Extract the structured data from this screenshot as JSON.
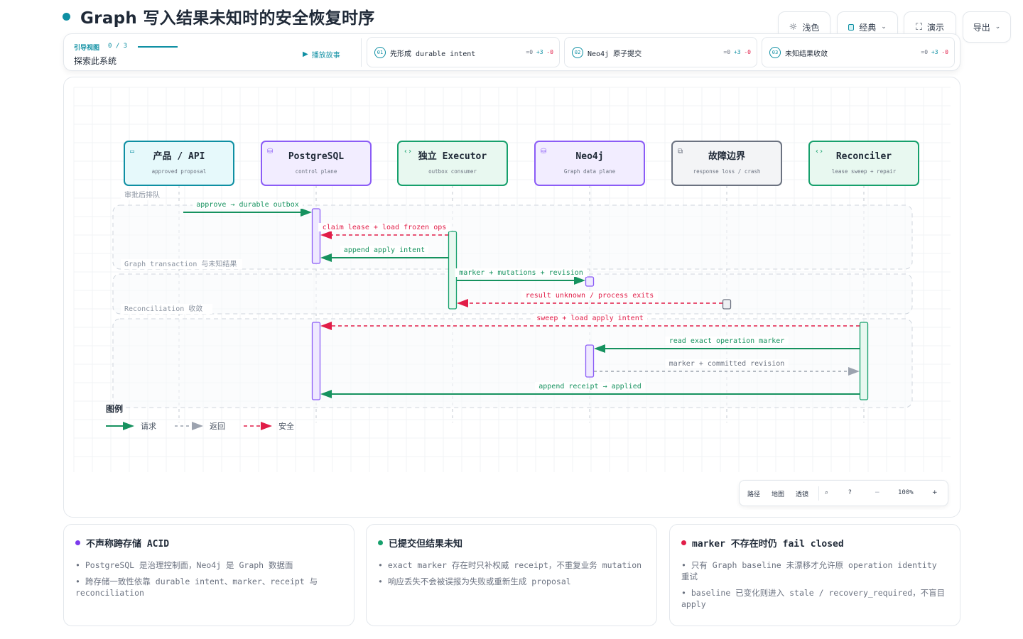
{
  "header": {
    "title": "Graph  写入结果未知时的安全恢复时序"
  },
  "toolbar": {
    "light_label": "浅色",
    "theme_label": "经典",
    "present_label": "演示",
    "export_label": "导出"
  },
  "guide": {
    "label": "引导视图",
    "count": "0 / 3",
    "subtitle": "探索此系统",
    "play_label": "播放故事",
    "steps": [
      {
        "num": "01",
        "title": "先形成 durable intent",
        "delta_eq": "=0",
        "delta_plus": "+3",
        "delta_minus": "-0"
      },
      {
        "num": "02",
        "title": "Neo4j 原子提交",
        "delta_eq": "=0",
        "delta_plus": "+3",
        "delta_minus": "-0"
      },
      {
        "num": "03",
        "title": "未知结果收敛",
        "delta_eq": "=0",
        "delta_plus": "+3",
        "delta_minus": "-0"
      }
    ]
  },
  "participants": [
    {
      "name": "产品 / API",
      "sub": "approved proposal",
      "icon": "window-icon",
      "color": "#0e8fa3",
      "fill": "#e6f9fb"
    },
    {
      "name": "PostgreSQL",
      "sub": "control plane",
      "icon": "database-icon",
      "color": "#8b5cf6",
      "fill": "#f2edff"
    },
    {
      "name": "独立 Executor",
      "sub": "outbox consumer",
      "icon": "code-icon",
      "color": "#16a06c",
      "fill": "#e8f8f0"
    },
    {
      "name": "Neo4j",
      "sub": "Graph data plane",
      "icon": "database-icon",
      "color": "#8b5cf6",
      "fill": "#f2edff"
    },
    {
      "name": "故障边界",
      "sub": "response loss / crash",
      "icon": "external-link-icon",
      "color": "#6b7280",
      "fill": "#f3f4f6"
    },
    {
      "name": "Reconciler",
      "sub": "lease sweep + repair",
      "icon": "code-icon",
      "color": "#16a06c",
      "fill": "#e8f8f0"
    }
  ],
  "groups": [
    {
      "label": "审批后排队"
    },
    {
      "label": "Graph transaction 与未知结果"
    },
    {
      "label": "Reconciliation 收敛"
    }
  ],
  "messages": [
    {
      "from": 0,
      "to": 1,
      "label": "approve → durable outbox",
      "kind": "request",
      "seq": 1
    },
    {
      "from": 2,
      "to": 1,
      "label": "claim lease + load frozen ops",
      "kind": "safety",
      "seq": 2
    },
    {
      "from": 2,
      "to": 1,
      "label": "append apply intent",
      "kind": "request",
      "seq": 3
    },
    {
      "from": 2,
      "to": 3,
      "label": "marker + mutations + revision",
      "kind": "request",
      "seq": 4
    },
    {
      "from": 4,
      "to": 2,
      "label": "result unknown / process exits",
      "kind": "safety",
      "seq": 5
    },
    {
      "from": 5,
      "to": 1,
      "label": "sweep + load apply intent",
      "kind": "safety",
      "seq": 6
    },
    {
      "from": 5,
      "to": 3,
      "label": "read exact operation marker",
      "kind": "request",
      "seq": 7
    },
    {
      "from": 3,
      "to": 5,
      "label": "marker + committed revision",
      "kind": "return",
      "seq": 8
    },
    {
      "from": 5,
      "to": 1,
      "label": "append receipt → applied",
      "kind": "request",
      "seq": 9
    }
  ],
  "legend": {
    "title": "图例",
    "items": [
      {
        "label": "请求",
        "kind": "request"
      },
      {
        "label": "返回",
        "kind": "return"
      },
      {
        "label": "安全",
        "kind": "safety"
      }
    ]
  },
  "colors": {
    "accent": "#0e8fa3",
    "request": "#16925f",
    "return": "#9ca3af",
    "safety": "#e11d48"
  },
  "zoom": {
    "path_label": "路径",
    "map_label": "地图",
    "lens_label": "透镜",
    "level": "100%"
  },
  "cards": [
    {
      "title": "不声称跨存储 ACID",
      "dot": "#7c3aed",
      "bullets": [
        "PostgreSQL 是治理控制面，Neo4j 是 Graph 数据面",
        "跨存储一致性依靠 durable intent、marker、receipt 与 reconciliation"
      ]
    },
    {
      "title": "已提交但结果未知",
      "dot": "#16a06c",
      "bullets": [
        "exact marker 存在时只补权威 receipt，不重复业务 mutation",
        "响应丢失不会被误报为失败或重新生成 proposal"
      ]
    },
    {
      "title": "marker 不存在时仍 fail closed",
      "dot": "#e11d48",
      "bullets": [
        "只有 Graph baseline 未漂移才允许原 operation identity 重试",
        "baseline 已变化则进入 stale / recovery_required，不盲目 apply"
      ]
    }
  ]
}
